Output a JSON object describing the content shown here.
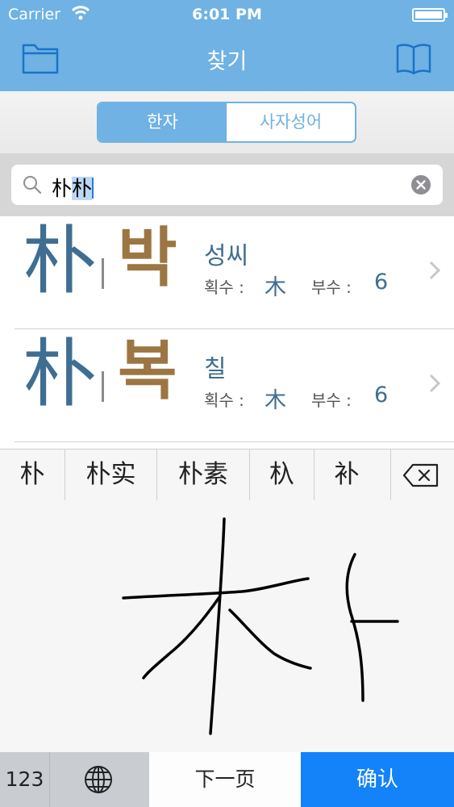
{
  "status_bar": {
    "carrier": "Carrier",
    "time": "6:01 PM"
  },
  "header": {
    "title": "찾기",
    "left_icon": "folder-icon",
    "right_icon": "book-icon",
    "color": "#6fb2e3"
  },
  "segments": [
    {
      "label": "한자",
      "selected": true
    },
    {
      "label": "사자성어",
      "selected": false
    }
  ],
  "search": {
    "typed": "朴",
    "marked": "朴",
    "clear_icon": "clear-icon"
  },
  "results": [
    {
      "hanja": "朴",
      "hangul": "박",
      "meaning": "성씨",
      "stroke_label": "획수 :",
      "radical": "木",
      "radical_label": "부수 :",
      "count": "6"
    },
    {
      "hanja": "朴",
      "hangul": "복",
      "meaning": "칠",
      "stroke_label": "획수 :",
      "radical": "木",
      "radical_label": "부수 :",
      "count": "6"
    }
  ],
  "candidates": [
    "朴",
    "朴实",
    "朴素",
    "杁",
    "补"
  ],
  "keyboard": {
    "numbers": "123",
    "next_page": "下一页",
    "confirm": "确认",
    "confirm_color": "#1482f8"
  }
}
